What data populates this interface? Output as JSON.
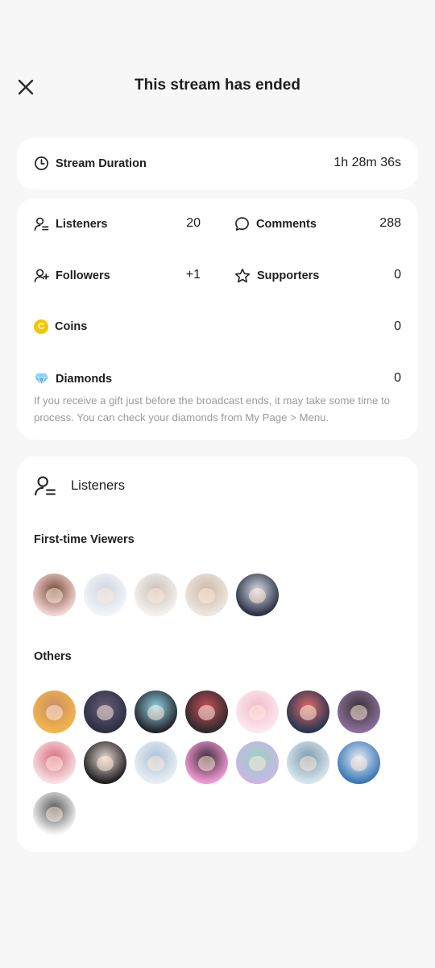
{
  "header": {
    "title": "This stream has ended"
  },
  "duration": {
    "label": "Stream Duration",
    "value": "1h 28m 36s"
  },
  "stats": {
    "listeners": {
      "label": "Listeners",
      "value": "20"
    },
    "comments": {
      "label": "Comments",
      "value": "288"
    },
    "followers": {
      "label": "Followers",
      "value": "+1"
    },
    "supporters": {
      "label": "Supporters",
      "value": "0"
    },
    "coins": {
      "label": "Coins",
      "value": "0",
      "icon_letter": "C"
    },
    "diamonds": {
      "label": "Diamonds",
      "value": "0"
    },
    "note": "If you receive a gift just before the broadcast ends, it may take some time to process. You can check your diamonds from My Page > Menu."
  },
  "listeners_section": {
    "title": "Listeners",
    "first_time_label": "First-time Viewers",
    "others_label": "Others",
    "first_time_avatars": [
      {
        "colors": [
          "#f3d7d4",
          "#7a4a3a"
        ]
      },
      {
        "colors": [
          "#f2f4f8",
          "#cfd6e0"
        ]
      },
      {
        "colors": [
          "#f4f1ee",
          "#c8c0bb"
        ]
      },
      {
        "colors": [
          "#efe6df",
          "#c9b8a6"
        ]
      },
      {
        "colors": [
          "#2b3144",
          "#d9dde6"
        ]
      }
    ],
    "other_avatars": [
      {
        "colors": [
          "#f3b54a",
          "#c98c6a"
        ]
      },
      {
        "colors": [
          "#2a2f42",
          "#6a5d7a"
        ]
      },
      {
        "colors": [
          "#222228",
          "#8fd5e8"
        ]
      },
      {
        "colors": [
          "#2d2a2c",
          "#c94d5a"
        ]
      },
      {
        "colors": [
          "#fbe9ef",
          "#f1b9c9"
        ]
      },
      {
        "colors": [
          "#26354f",
          "#e46a6a"
        ]
      },
      {
        "colors": [
          "#8a6f9a",
          "#3b3033"
        ]
      },
      {
        "colors": [
          "#f6e1e6",
          "#d96b7a"
        ]
      },
      {
        "colors": [
          "#1e1e22",
          "#e9d8cf"
        ]
      },
      {
        "colors": [
          "#e9eef4",
          "#a9c0d6"
        ]
      },
      {
        "colors": [
          "#f39ad6",
          "#3a2a33"
        ]
      },
      {
        "colors": [
          "#c9b7e6",
          "#9ad0c2"
        ]
      },
      {
        "colors": [
          "#d7e6ec",
          "#7c9aae"
        ]
      },
      {
        "colors": [
          "#3a77b6",
          "#e8eef6"
        ]
      },
      {
        "colors": [
          "#f4f4f4",
          "#555555"
        ]
      }
    ]
  }
}
